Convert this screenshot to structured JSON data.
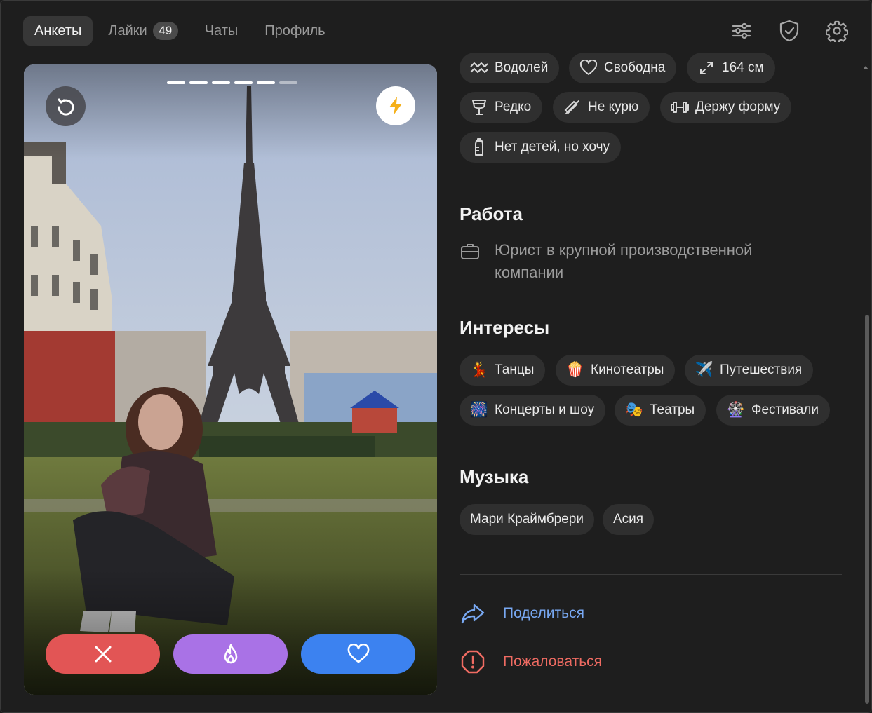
{
  "nav": {
    "tabs": [
      {
        "label": "Анкеты",
        "active": true
      },
      {
        "label": "Лайки",
        "badge": "49"
      },
      {
        "label": "Чаты"
      },
      {
        "label": "Профиль"
      }
    ],
    "icons": [
      "filters-icon",
      "shield-check-icon",
      "settings-gear-icon"
    ]
  },
  "photo": {
    "count": 6,
    "current_index": 5,
    "buttons": {
      "undo": "undo-arrow-icon",
      "boost": "lightning-bolt-icon",
      "dislike": "close-x-icon",
      "superlike": "flame-icon",
      "like": "heart-icon"
    },
    "colors": {
      "dislike": "#e25555",
      "superlike": "#a972e6",
      "like": "#3c82f0"
    }
  },
  "profile": {
    "basics": [
      {
        "icon": "zodiac-aquarius-icon",
        "label": "Водолей"
      },
      {
        "icon": "heart-outline-icon",
        "label": "Свободна"
      },
      {
        "icon": "height-arrows-icon",
        "label": "164 см"
      },
      {
        "icon": "wine-glass-icon",
        "label": "Редко"
      },
      {
        "icon": "no-smoking-icon",
        "label": "Не курю"
      },
      {
        "icon": "dumbbell-icon",
        "label": "Держу форму"
      },
      {
        "icon": "baby-bottle-icon",
        "label": "Нет детей, но хочу"
      }
    ],
    "work": {
      "title": "Работа",
      "icon": "briefcase-icon",
      "text": "Юрист в крупной производственной компании"
    },
    "interests": {
      "title": "Интересы",
      "items": [
        {
          "emoji": "💃",
          "label": "Танцы"
        },
        {
          "emoji": "🍿",
          "label": "Кинотеатры"
        },
        {
          "emoji": "✈️",
          "label": "Путешествия"
        },
        {
          "emoji": "🎆",
          "label": "Концерты и шоу"
        },
        {
          "emoji": "🎭",
          "label": "Театры"
        },
        {
          "emoji": "🎡",
          "label": "Фестивали"
        }
      ]
    },
    "music": {
      "title": "Музыка",
      "items": [
        "Мари Краймбрери",
        "Асия"
      ]
    },
    "links": {
      "share": "Поделиться",
      "report": "Пожаловаться"
    }
  },
  "colors": {
    "background": "#1e1e1e",
    "chip": "#2f2f2f",
    "share": "#78a8f2",
    "report": "#ef6b62"
  }
}
